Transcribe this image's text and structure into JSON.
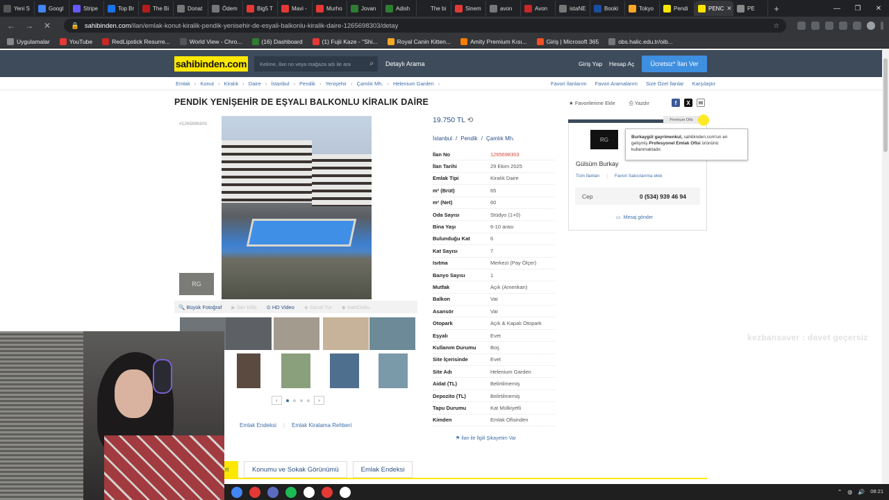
{
  "browser": {
    "tabs": [
      {
        "label": "Yeni S",
        "color": "#555"
      },
      {
        "label": "Googl",
        "color": "#4285f4"
      },
      {
        "label": "Stripe",
        "color": "#635bff"
      },
      {
        "label": "Top Br",
        "color": "#1a73e8"
      },
      {
        "label": "The Bi",
        "color": "#b71c1c"
      },
      {
        "label": "Donat",
        "color": "#777"
      },
      {
        "label": "Ödem",
        "color": "#777"
      },
      {
        "label": "Big5 T",
        "color": "#e53935"
      },
      {
        "label": "Mavi -",
        "color": "#e53935"
      },
      {
        "label": "Murho",
        "color": "#e53935"
      },
      {
        "label": "Jovan",
        "color": "#2e7d32"
      },
      {
        "label": "Adish",
        "color": "#2e7d32"
      },
      {
        "label": "The bi",
        "color": "#222"
      },
      {
        "label": "Sinem",
        "color": "#e53935"
      },
      {
        "label": "avon",
        "color": "#777"
      },
      {
        "label": "Avon",
        "color": "#c62828"
      },
      {
        "label": "istaNE",
        "color": "#777"
      },
      {
        "label": "Booki",
        "color": "#1a4ea1"
      },
      {
        "label": "Tokyo",
        "color": "#f9a825"
      },
      {
        "label": "Pendi",
        "color": "#f9e400"
      },
      {
        "label": "PENC",
        "color": "#f9e400"
      },
      {
        "label": "PE",
        "color": "#888"
      }
    ],
    "new_tab": "+",
    "url_host": "sahibinden.com",
    "url_path": "/ilan/emlak-konut-kiralik-pendik-yenisehir-de-esyali-balkonlu-kiralik-daire-1265698303/detay",
    "bookmarks": [
      {
        "label": "Uygulamalar",
        "color": "#888"
      },
      {
        "label": "YouTube",
        "color": "#e53935"
      },
      {
        "label": "RedLipstick Resurre...",
        "color": "#c62828"
      },
      {
        "label": "World View - Chro...",
        "color": "#555"
      },
      {
        "label": "(16) Dashboard",
        "color": "#2e7d32"
      },
      {
        "label": "(1) Fujii Kaze - \"Shi...",
        "color": "#e53935"
      },
      {
        "label": "Royal Canin Kitten...",
        "color": "#f9a825"
      },
      {
        "label": "Amity Premium Kısı...",
        "color": "#f57c00"
      },
      {
        "label": "Giriş | Microsoft 365",
        "color": "#f25022"
      },
      {
        "label": "obs.halic.edu.tr/oib...",
        "color": "#777"
      }
    ]
  },
  "header": {
    "logo": "sahibinden.com",
    "search_placeholder": "Kelime, ilan no veya mağaza adı ile ara",
    "detailed_search": "Detaylı Arama",
    "login": "Giriş Yap",
    "register": "Hesap Aç",
    "post_button": "Ücretsiz* İlan Ver"
  },
  "breadcrumbs": [
    "Emlak",
    "Konut",
    "Kiralık",
    "Daire",
    "İstanbul",
    "Pendik",
    "Yenişehir",
    "Çamlık Mh.",
    "Helenium Garden"
  ],
  "top_links": [
    "Favori İlanlarım",
    "Favori Aramalarım",
    "Size Özel İlanlar",
    "Karşılaştır"
  ],
  "listing": {
    "title": "PENDİK YENİŞEHİR DE EŞYALI BALKONLU KİRALIK DAİRE",
    "favorite": "Favorilerime Ekle",
    "print": "Yazdır",
    "side_id": "#1265698303",
    "price": "19.750 TL",
    "location": [
      "İstanbul",
      "Pendik",
      "Çamlık Mh."
    ],
    "attributes": [
      {
        "key": "İlan No",
        "value": "1265698303",
        "red": true
      },
      {
        "key": "İlan Tarihi",
        "value": "29 Ekim 2025"
      },
      {
        "key": "Emlak Tipi",
        "value": "Kiralık Daire"
      },
      {
        "key": "m² (Brüt)",
        "value": "65"
      },
      {
        "key": "m² (Net)",
        "value": "60"
      },
      {
        "key": "Oda Sayısı",
        "value": "Stüdyo (1+0)"
      },
      {
        "key": "Bina Yaşı",
        "value": "6-10 arası"
      },
      {
        "key": "Bulunduğu Kat",
        "value": "6"
      },
      {
        "key": "Kat Sayısı",
        "value": "7"
      },
      {
        "key": "Isıtma",
        "value": "Merkezi (Pay Ölçer)"
      },
      {
        "key": "Banyo Sayısı",
        "value": "1"
      },
      {
        "key": "Mutfak",
        "value": "Açık (Amerikan)"
      },
      {
        "key": "Balkon",
        "value": "Var"
      },
      {
        "key": "Asansör",
        "value": "Var"
      },
      {
        "key": "Otopark",
        "value": "Açık & Kapalı Otopark"
      },
      {
        "key": "Eşyalı",
        "value": "Evet"
      },
      {
        "key": "Kullanım Durumu",
        "value": "Boş"
      },
      {
        "key": "Site İçerisinde",
        "value": "Evet"
      },
      {
        "key": "Site Adı",
        "value": "Helenium Garden"
      },
      {
        "key": "Aidat (TL)",
        "value": "Belirtilmemiş"
      },
      {
        "key": "Depozito (TL)",
        "value": "Belirtilmemiş"
      },
      {
        "key": "Tapu Durumu",
        "value": "Kat Mülkiyetli"
      },
      {
        "key": "Kimden",
        "value": "Emlak Ofisinden"
      }
    ],
    "complaint": "İlan ile İlgili Şikayetim Var"
  },
  "photo_bar": {
    "big_photo": "Büyük Fotoğraf",
    "clip": "İlan Klibi",
    "hd_video": "HD Video",
    "virtual_tour": "Sanal Tur",
    "sahibi_doku": "SahiDoku"
  },
  "bottom_links": [
    "Emlak Endeksi",
    "Emlak Kiralama Rehberi"
  ],
  "bottom_tabs": [
    "Konumu ve Sokak Görünümü",
    "Emlak Endeksi"
  ],
  "bottom_tab_partial": "ri",
  "seller": {
    "premium": "Premium Ofis",
    "logo": "RG",
    "name": "Gülsüm Burkay",
    "all_listings": "Tüm İlanları",
    "favorite_seller": "Favori Satıcılarıma ekle",
    "phone_label": "Cep",
    "phone": "0 (534) 939 46 94",
    "message": "Mesaj gönder",
    "tooltip_lead": "Burkaygül gayrimenkul,",
    "tooltip_mid": " sahibinden.com'un en gelişmiş ",
    "tooltip_bold": "Profesyonel Emlak Ofisi",
    "tooltip_tail": " ürününü kullanmaktadır."
  },
  "watermark": "kezbansaver : davet geçersiz",
  "taskbar": {
    "time": "08:21",
    "icons": [
      "#4285f4",
      "#e53935",
      "#5c6bc0",
      "#1db954",
      "#ffffff",
      "#e53935",
      "#ffffff"
    ]
  }
}
